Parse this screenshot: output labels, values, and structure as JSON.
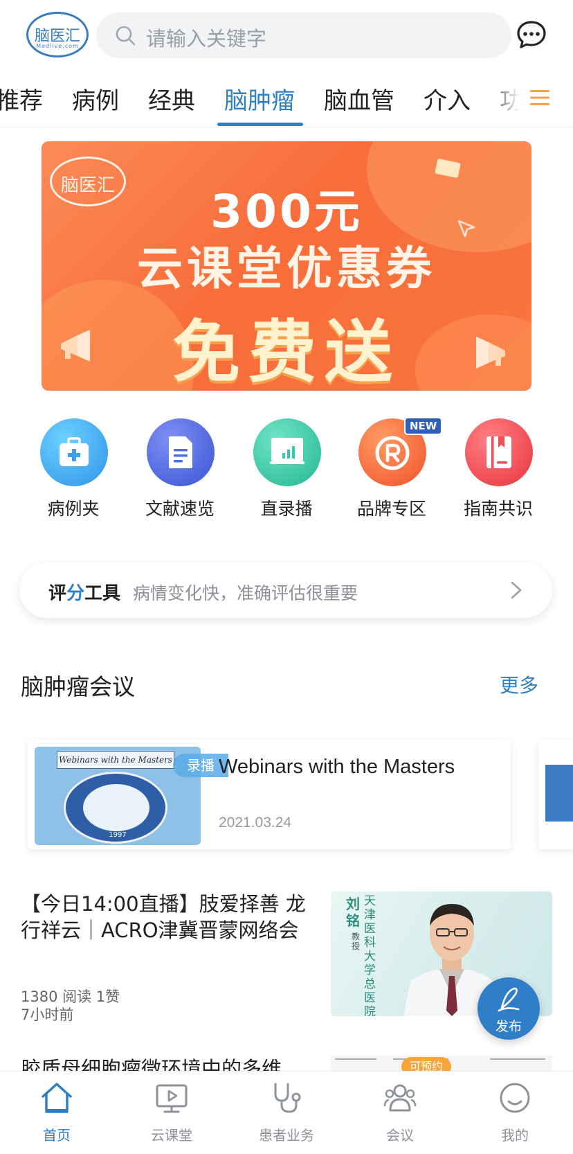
{
  "header": {
    "logo_text": "脑医汇",
    "logo_sub": "Medlive.com",
    "search_placeholder": "请输入关键字"
  },
  "tabs": [
    {
      "label": "推荐",
      "active": false
    },
    {
      "label": "病例",
      "active": false
    },
    {
      "label": "经典",
      "active": false
    },
    {
      "label": "脑肿瘤",
      "active": true
    },
    {
      "label": "脑血管",
      "active": false
    },
    {
      "label": "介入",
      "active": false
    },
    {
      "label": "功",
      "active": false
    }
  ],
  "banner": {
    "logo_text": "脑医汇",
    "line1": "300元",
    "line2": "云课堂优惠券",
    "line3": "免费送"
  },
  "quick_links": [
    {
      "label": "病例夹",
      "icon": "medical-kit-icon",
      "color": "#3aa8ec"
    },
    {
      "label": "文献速览",
      "icon": "document-icon",
      "color": "#4e6fe0"
    },
    {
      "label": "直录播",
      "icon": "presentation-icon",
      "color": "#34c8a6"
    },
    {
      "label": "品牌专区",
      "icon": "registered-icon",
      "color": "#f4633a",
      "badge": "NEW"
    },
    {
      "label": "指南共识",
      "icon": "book-icon",
      "color": "#f04e55"
    }
  ],
  "rating_tool": {
    "title_a": "评",
    "title_b": "分",
    "title_c": "工具",
    "subtitle": "病情变化快，准确评估很重要"
  },
  "section": {
    "title": "脑肿瘤会议",
    "more": "更多"
  },
  "meeting": {
    "thumb_title": "Webinars with the Masters",
    "thumb_year": "1997",
    "tag": "录播",
    "title": "Webinars with the Masters",
    "date": "2021.03.24"
  },
  "article": {
    "title": "【今日14:00直播】肢爱择善 龙行祥云｜ACRO津冀晋蒙网络会",
    "reads": "1380 阅读 1赞",
    "time": "7小时前",
    "img_name": "刘铭",
    "img_title": "教授",
    "img_org": "天津医科大学总医院"
  },
  "article2": {
    "title": "胶质母细胞瘤微环境中的多维",
    "badge": "可预约"
  },
  "fab": {
    "label": "发布"
  },
  "bottom_nav": [
    {
      "label": "首页",
      "icon": "home-icon",
      "active": true
    },
    {
      "label": "云课堂",
      "icon": "video-screen-icon",
      "active": false
    },
    {
      "label": "患者业务",
      "icon": "stethoscope-icon",
      "active": false
    },
    {
      "label": "会议",
      "icon": "people-icon",
      "active": false
    },
    {
      "label": "我的",
      "icon": "profile-smile-icon",
      "active": false
    }
  ],
  "colors": {
    "accent": "#2f80c3",
    "banner": "#f86d3a",
    "badge_orange": "#f7a43a"
  }
}
